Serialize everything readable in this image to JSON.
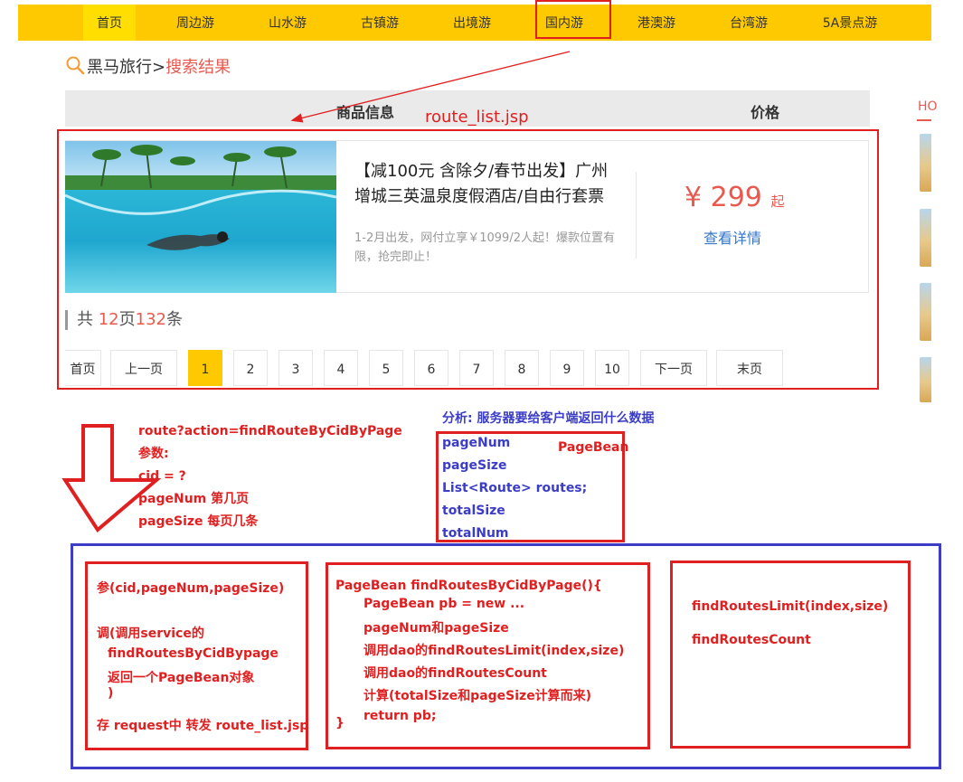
{
  "nav": {
    "items": [
      "首页",
      "周边游",
      "山水游",
      "古镇游",
      "出境游",
      "国内游",
      "港澳游",
      "台湾游",
      "5A景点游"
    ],
    "active": "首页",
    "highlighted": "国内游",
    "bg_color": "#ffc900"
  },
  "breadcrumb": {
    "site": "黑马旅行",
    "sep": ">",
    "current": "搜索结果"
  },
  "table_header": {
    "info": "商品信息",
    "price": "价格"
  },
  "jsp_label": "route_list.jsp",
  "route": {
    "title": "【减100元 含除夕/春节出发】广州增城三英温泉度假酒店/自由行套票",
    "desc": "1-2月出发，网付立享￥1099/2人起！爆款位置有限，抢完即止！",
    "price": "¥ 299",
    "price_suffix": "起",
    "detail_link": "查看详情"
  },
  "summary": {
    "prefix": "共",
    "pages": "12",
    "pages_unit": "页",
    "count": "132",
    "count_unit": "条"
  },
  "pagination": {
    "first": "首页",
    "prev": "上一页",
    "pages": [
      "1",
      "2",
      "3",
      "4",
      "5",
      "6",
      "7",
      "8",
      "9",
      "10"
    ],
    "current": "1",
    "next": "下一页",
    "last": "末页"
  },
  "sidebar": {
    "hot": "HO"
  },
  "diagram": {
    "request": {
      "url": "route?action=findRouteByCidByPage",
      "params_label": "参数:",
      "cid": "cid = ?",
      "pageNum": "pageNum 第几页",
      "pageSize": "pageSize 每页几条"
    },
    "analysis": {
      "title": "分析: 服务器要给客户端返回什么数据",
      "fields": [
        "pageNum",
        "pageSize",
        "List<Route> routes;",
        "totalSize",
        "totalNum"
      ],
      "class_name": "PageBean"
    },
    "servlet": {
      "lines": [
        "参(cid,pageNum,pageSize)",
        "调(调用service的",
        "findRoutesByCidBypage",
        "返回一个PageBean对象",
        ")",
        "存  request中  转发 route_list.jsp"
      ]
    },
    "service": {
      "lines": [
        "PageBean findRoutesByCidByPage(){",
        "PageBean pb = new ...",
        "pageNum和pageSize",
        "调用dao的findRoutesLimit(index,size)",
        "调用dao的findRoutesCount",
        "计算(totalSize和pageSize计算而来)",
        "return pb;",
        "}"
      ]
    },
    "dao": {
      "lines": [
        "findRoutesLimit(index,size)",
        "findRoutesCount"
      ]
    }
  }
}
